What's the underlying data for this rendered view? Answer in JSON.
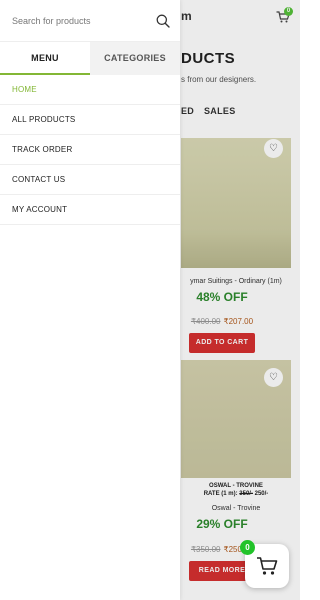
{
  "background_page": {
    "brand_fragment": "m",
    "cart_count": "0",
    "section_title": "DUCTS",
    "section_subtitle": "s from our designers.",
    "filter_tabs": [
      "ED",
      "SALES"
    ],
    "products": [
      {
        "name": "ymar Suitings - Ordinary (1m)",
        "overlay_text": "",
        "discount": "48% OFF",
        "old_price": "₹400.00",
        "new_price": "₹207.00",
        "button_label": "ADD TO CART"
      },
      {
        "name": "Oswal - Trovine",
        "overlay_text": "OSWAL - TROVINE\nRATE (1 m): 350/- 250/-",
        "discount": "29% OFF",
        "old_price": "₹350.00",
        "new_price": "₹250.00",
        "button_label": "READ MORE"
      }
    ]
  },
  "floating_cart": {
    "count": "0",
    "icon": "cart-icon"
  },
  "drawer": {
    "search": {
      "placeholder": "Search for products",
      "value": "",
      "icon": "search-icon"
    },
    "tabs": [
      {
        "label": "MENU",
        "active": true
      },
      {
        "label": "CATEGORIES",
        "active": false
      }
    ],
    "menu_items": [
      {
        "label": "HOME",
        "active": true
      },
      {
        "label": "ALL PRODUCTS",
        "active": false
      },
      {
        "label": "TRACK ORDER",
        "active": false
      },
      {
        "label": "CONTACT US",
        "active": false
      },
      {
        "label": "MY ACCOUNT",
        "active": false
      }
    ]
  },
  "colors": {
    "accent": "#83b735",
    "discount": "#2e8b2e",
    "cta": "#d63030",
    "badge": "#22c32a"
  }
}
